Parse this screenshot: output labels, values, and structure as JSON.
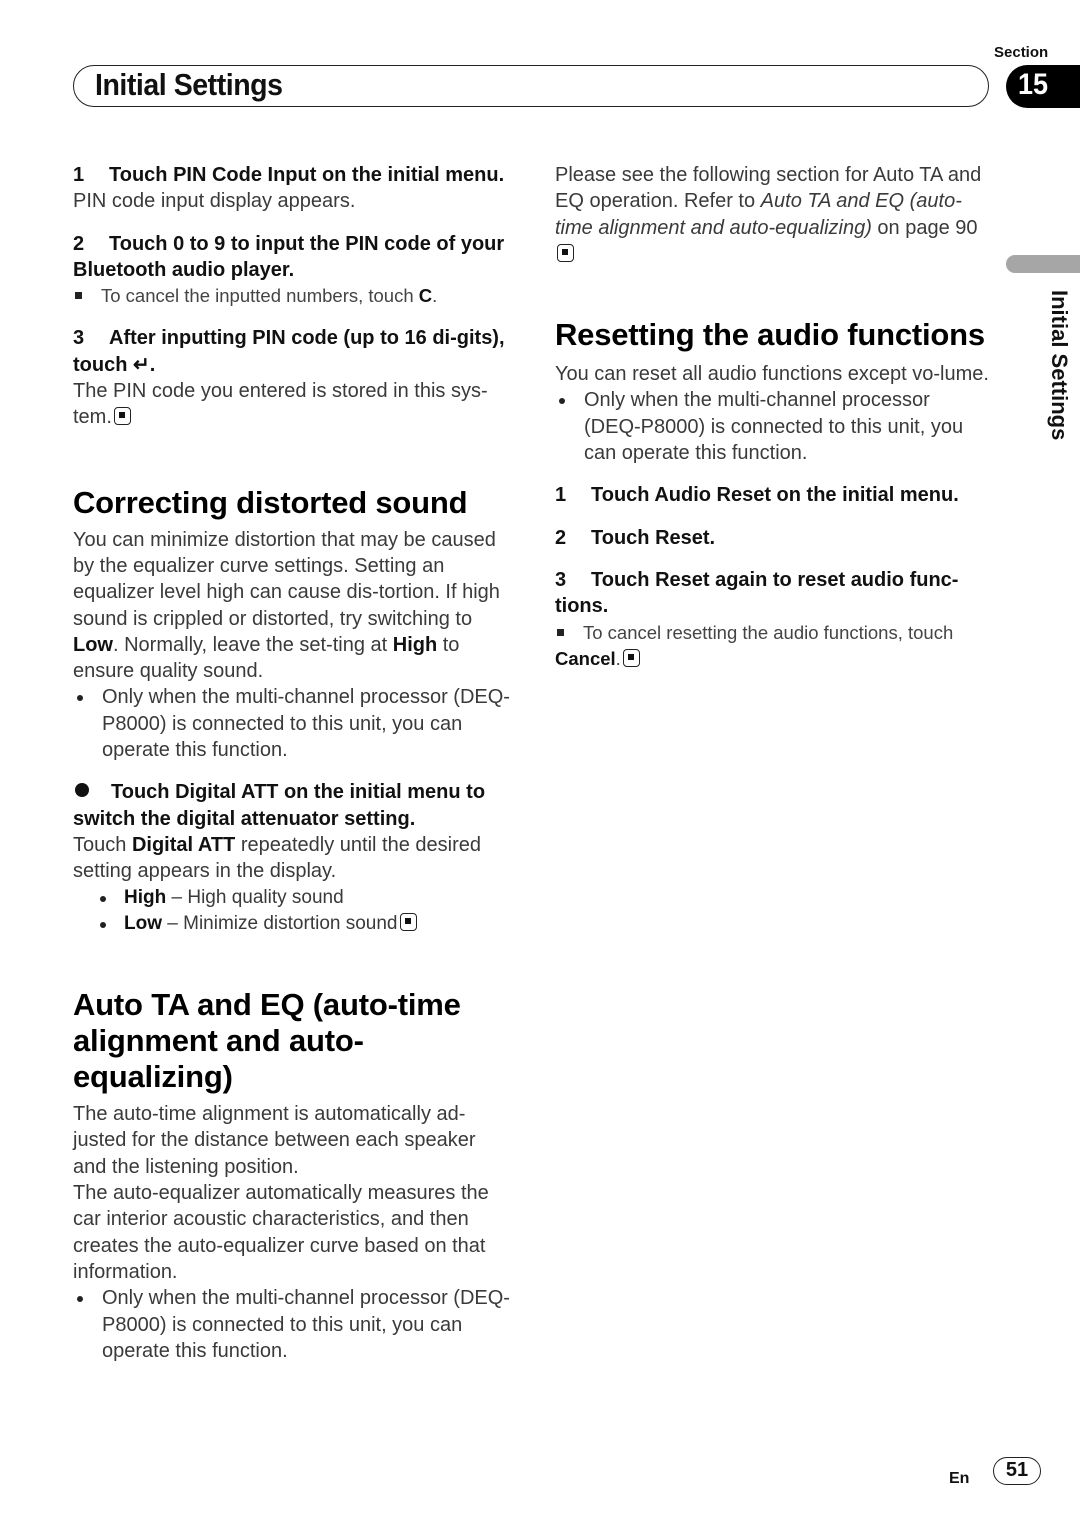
{
  "header": {
    "section_label": "Section",
    "section_number": "15",
    "title": "Initial Settings",
    "side_label": "Initial Settings"
  },
  "left": {
    "pin_steps": [
      {
        "num": "1",
        "text": "Touch PIN Code Input on the initial menu.",
        "body": "PIN code input display appears."
      },
      {
        "num": "2",
        "text": "Touch 0 to 9 to input the PIN code of your Bluetooth audio player.",
        "note_prefix": "To cancel the inputted numbers, touch ",
        "note_bold": "C",
        "note_suffix": "."
      },
      {
        "num": "3",
        "text_prefix": "After inputting PIN code (up to 16 di-gits), touch ",
        "enter_symbol": "↵",
        "text_suffix": ".",
        "body": "The PIN code you entered is stored in this sys-tem."
      }
    ],
    "correcting": {
      "heading": "Correcting distorted sound",
      "p1": "You can minimize distortion that may be caused by the equalizer curve settings. Setting an equalizer level high can cause dis-tortion. If high sound is crippled or distorted, try switching to ",
      "p1_bold1": "Low",
      "p1_mid": ". Normally, leave the set-ting at ",
      "p1_bold2": "High",
      "p1_end": " to ensure quality sound.",
      "bullet": "Only when the multi-channel processor (DEQ-P8000) is connected to this unit, you can operate this function.",
      "step_text": "Touch Digital ATT on the initial menu to switch the digital attenuator setting.",
      "step_body_prefix": "Touch ",
      "step_body_bold": "Digital ATT",
      "step_body_suffix": " repeatedly until the desired setting appears in the display.",
      "options": [
        {
          "label": "High",
          "desc": " – High quality sound"
        },
        {
          "label": "Low",
          "desc": " – Minimize distortion sound"
        }
      ]
    },
    "auto_ta": {
      "heading": "Auto TA and EQ (auto-time alignment and auto-equalizing)",
      "p1": "The auto-time alignment is automatically ad-justed for the distance between each speaker and the listening position.",
      "p2": "The auto-equalizer automatically measures the car interior acoustic characteristics, and then creates the auto-equalizer curve based on that information.",
      "bullet": "Only when the multi-channel processor (DEQ-P8000) is connected to this unit, you can operate this function."
    }
  },
  "right": {
    "intro_prefix": "Please see the following section for Auto TA and EQ operation. Refer to ",
    "intro_italic": "Auto TA and EQ (auto-time alignment and auto-equalizing)",
    "intro_suffix": " on page 90",
    "resetting": {
      "heading": "Resetting the audio functions",
      "p1": "You can reset all audio functions except vo-lume.",
      "bullet": "Only when the multi-channel processor (DEQ-P8000) is connected to this unit, you can operate this function.",
      "steps": [
        {
          "num": "1",
          "text": "Touch Audio Reset on the initial menu."
        },
        {
          "num": "2",
          "text": "Touch Reset."
        },
        {
          "num": "3",
          "text": "Touch Reset again to reset audio func-tions."
        }
      ],
      "note_prefix": "To cancel resetting the audio functions, touch",
      "note_bold": "Cancel",
      "note_suffix": "."
    }
  },
  "footer": {
    "lang": "En",
    "page": "51"
  }
}
